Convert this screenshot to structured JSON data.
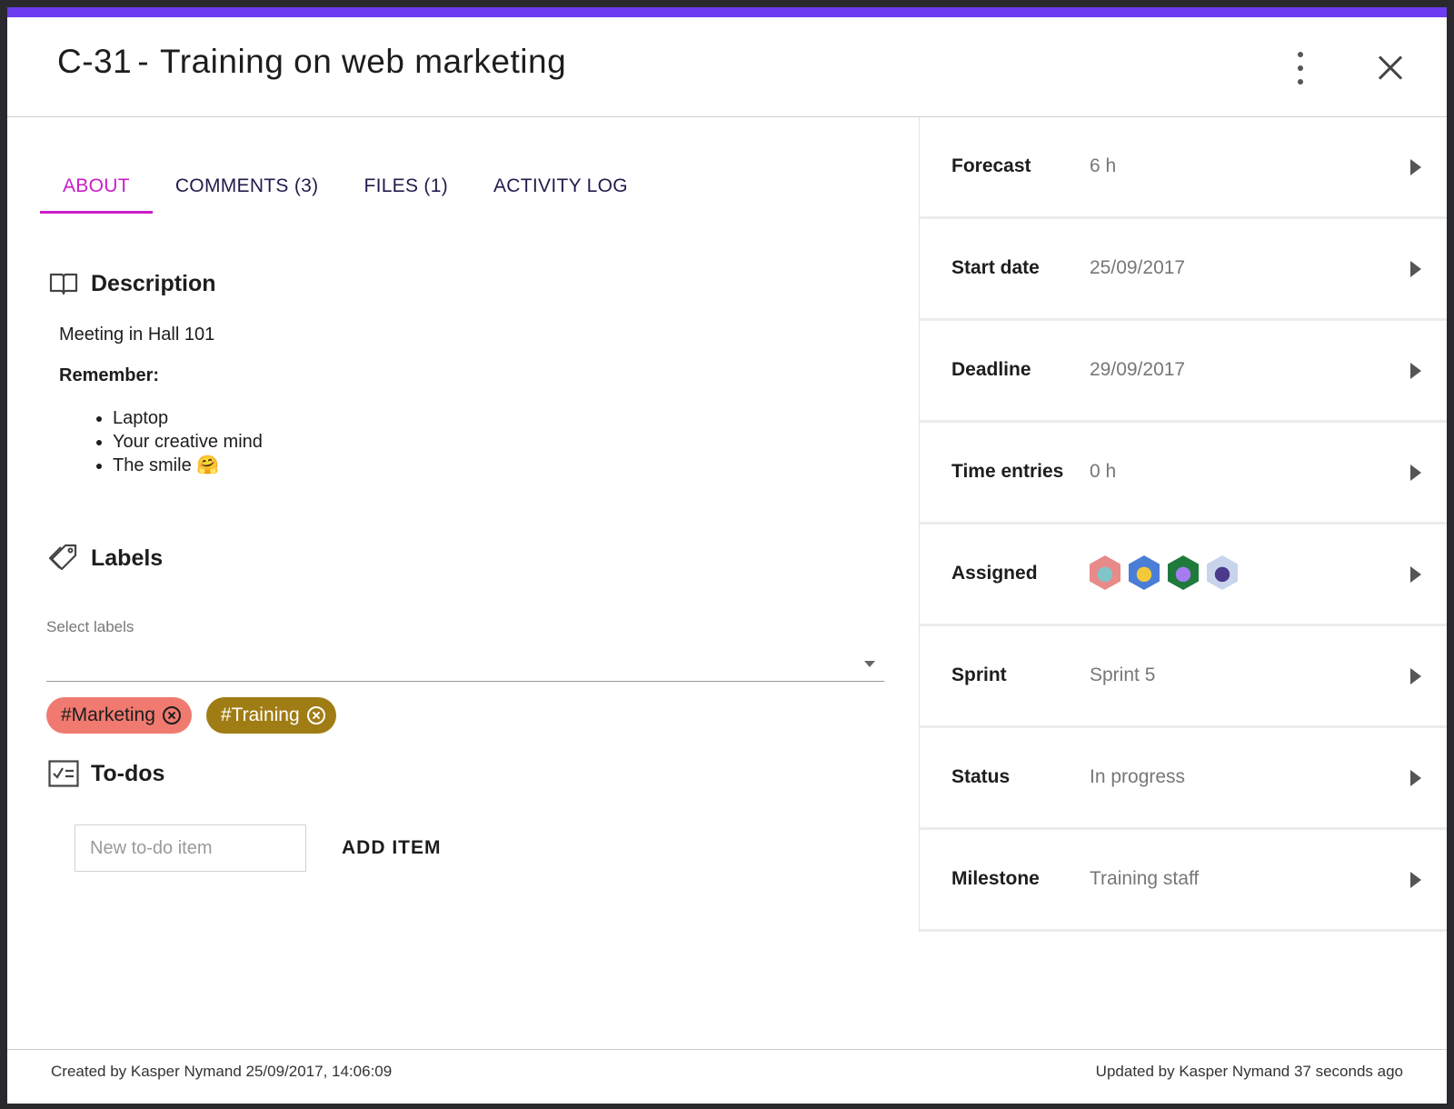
{
  "header": {
    "task_id": "C-31",
    "separator": "-",
    "title": "Training on web marketing"
  },
  "tabs": [
    {
      "label": "ABOUT",
      "active": true
    },
    {
      "label": "COMMENTS (3)",
      "active": false
    },
    {
      "label": "FILES (1)",
      "active": false
    },
    {
      "label": "ACTIVITY LOG",
      "active": false
    }
  ],
  "description": {
    "heading": "Description",
    "line1": "Meeting in Hall 101",
    "line2": "Remember:",
    "bullets": [
      "Laptop",
      "Your creative mind",
      "The smile 🤗"
    ]
  },
  "labels": {
    "heading": "Labels",
    "select_caption": "Select labels",
    "chips": [
      {
        "text": "#Marketing",
        "bg": "#f07a70",
        "fg": "#1d1d1d"
      },
      {
        "text": "#Training",
        "bg": "#a07c14",
        "fg": "#ffffff"
      }
    ]
  },
  "todos": {
    "heading": "To-dos",
    "placeholder": "New to-do item",
    "add_label": "ADD ITEM"
  },
  "fields": [
    {
      "key": "Forecast",
      "value": "6 h"
    },
    {
      "key": "Start date",
      "value": "25/09/2017"
    },
    {
      "key": "Deadline",
      "value": "29/09/2017"
    },
    {
      "key": "Time entries",
      "value": "0 h"
    },
    {
      "key": "Assigned",
      "value": ""
    },
    {
      "key": "Sprint",
      "value": "Sprint 5"
    },
    {
      "key": "Status",
      "value": "In progress"
    },
    {
      "key": "Milestone",
      "value": "Training staff"
    }
  ],
  "assignees": [
    {
      "name": "avatar-1",
      "color": "#e88a8a",
      "accent": "#7fc6c8"
    },
    {
      "name": "avatar-2",
      "color": "#4a7ed6",
      "accent": "#f3c93c"
    },
    {
      "name": "avatar-3",
      "color": "#1f7a3c",
      "accent": "#a47cf0"
    },
    {
      "name": "avatar-4",
      "color": "#c8d4ec",
      "accent": "#4a3a8a"
    }
  ],
  "footer": {
    "created": "Created by Kasper Nymand 25/09/2017, 14:06:09",
    "updated": "Updated by Kasper Nymand 37 seconds ago"
  },
  "colors": {
    "accent": "#6c3cf0",
    "tab_active": "#c81ec9",
    "tab_text": "#221b4d"
  }
}
